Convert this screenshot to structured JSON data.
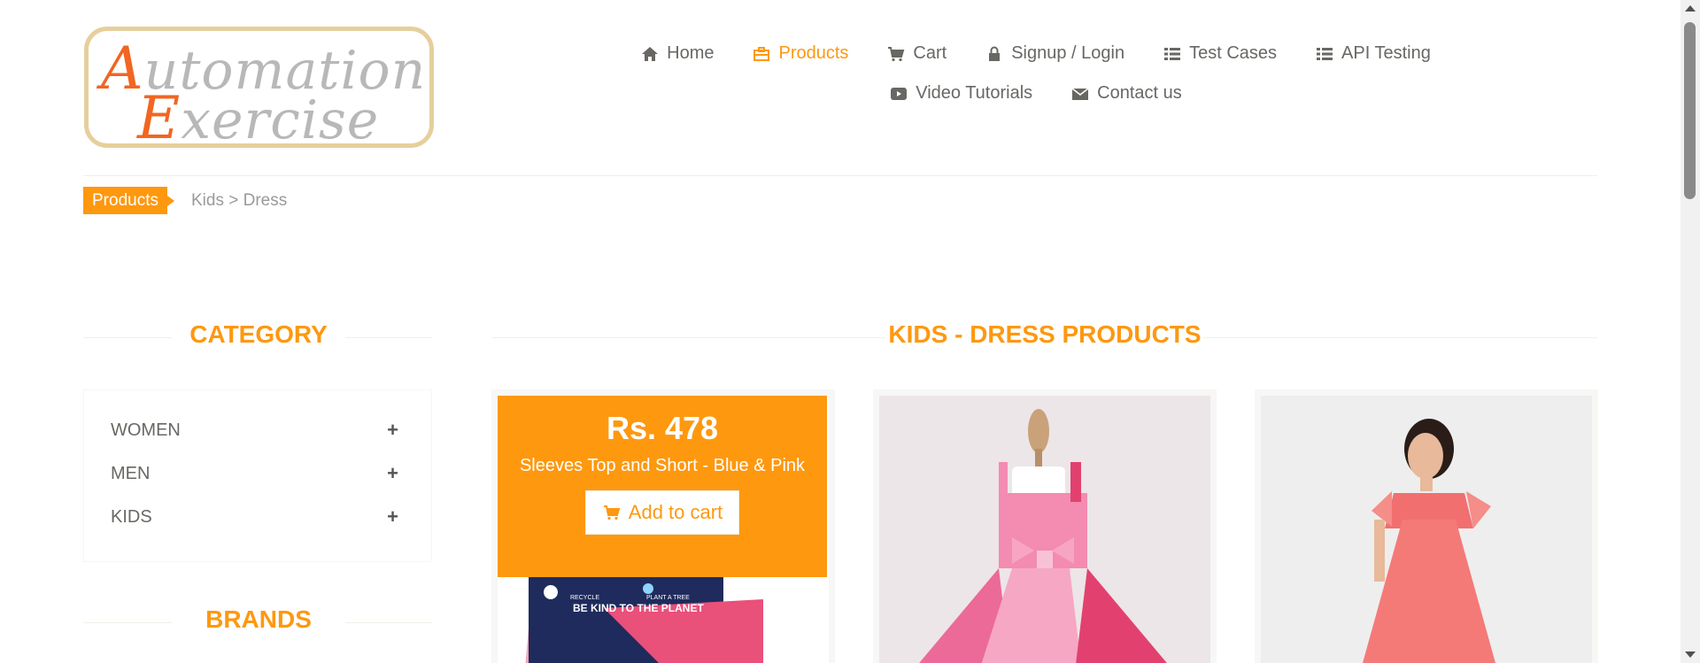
{
  "logo": {
    "line1_cap": "A",
    "line1_rest": "utomation",
    "line2_cap": "E",
    "line2_rest": "xercise"
  },
  "nav": {
    "items": [
      {
        "label": "Home",
        "icon": "home-icon"
      },
      {
        "label": "Products",
        "icon": "briefcase-icon",
        "active": true
      },
      {
        "label": "Cart",
        "icon": "cart-icon"
      },
      {
        "label": "Signup / Login",
        "icon": "lock-icon"
      },
      {
        "label": "Test Cases",
        "icon": "list-icon"
      },
      {
        "label": "API Testing",
        "icon": "list-icon"
      },
      {
        "label": "Video Tutorials",
        "icon": "youtube-play-icon"
      },
      {
        "label": "Contact us",
        "icon": "envelope-icon"
      }
    ]
  },
  "breadcrumb": {
    "active": "Products",
    "rest": "Kids > Dress"
  },
  "sidebar": {
    "category_title": "CATEGORY",
    "categories": [
      {
        "label": "WOMEN",
        "toggle": "+"
      },
      {
        "label": "MEN",
        "toggle": "+"
      },
      {
        "label": "KIDS",
        "toggle": "+"
      }
    ],
    "brands_title": "BRANDS"
  },
  "main": {
    "title": "KIDS - DRESS PRODUCTS",
    "products": [
      {
        "price": "Rs. 478",
        "name": "Sleeves Top and Short - Blue & Pink",
        "button": "Add to cart",
        "image_text_1": "BE KIND TO THE PLANET",
        "image_text_2": "RECYCLE",
        "image_text_3": "PLANT A TREE"
      },
      {
        "image": "pink-tutu-dress-image"
      },
      {
        "image": "coral-girl-dress-image"
      }
    ]
  },
  "colors": {
    "accent": "#fe980f",
    "text": "#696763",
    "divider": "#f0f0e9"
  }
}
